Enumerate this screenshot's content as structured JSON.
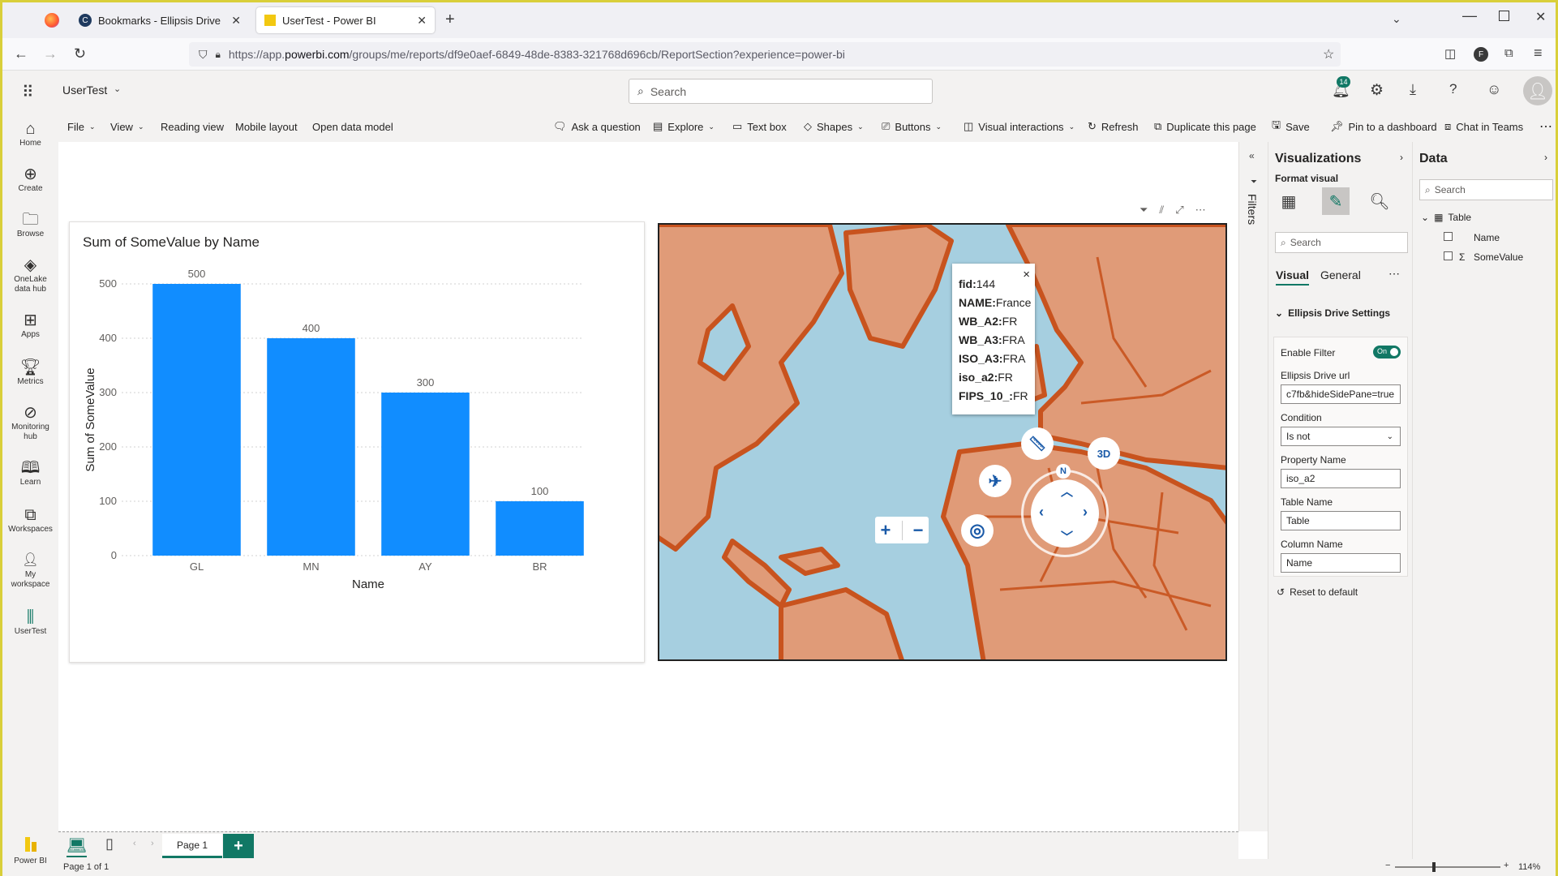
{
  "browser": {
    "tabs": [
      {
        "label": "Bookmarks - Ellipsis Drive"
      },
      {
        "label": "UserTest - Power BI"
      }
    ],
    "url_host": "https://app.",
    "url_domain": "powerbi.com",
    "url_path": "/groups/me/reports/df9e0aef-6849-48de-8383-321768d696cb/ReportSection?experience=power-bi",
    "profile_initial": "F"
  },
  "header": {
    "workspace": "UserTest",
    "search_placeholder": "Search",
    "notification_count": "14"
  },
  "ribbon": {
    "file": "File",
    "view": "View",
    "reading_view": "Reading view",
    "mobile_layout": "Mobile layout",
    "open_data_model": "Open data model",
    "ask_question": "Ask a question",
    "explore": "Explore",
    "text_box": "Text box",
    "shapes": "Shapes",
    "buttons": "Buttons",
    "visual_interactions": "Visual interactions",
    "refresh": "Refresh",
    "duplicate_page": "Duplicate this page",
    "save": "Save",
    "pin_dashboard": "Pin to a dashboard",
    "chat_teams": "Chat in Teams"
  },
  "leftnav": {
    "items": [
      {
        "label": "Home"
      },
      {
        "label": "Create"
      },
      {
        "label": "Browse"
      },
      {
        "label": "OneLake data hub"
      },
      {
        "label": "Apps"
      },
      {
        "label": "Metrics"
      },
      {
        "label": "Monitoring hub"
      },
      {
        "label": "Learn"
      },
      {
        "label": "Workspaces"
      },
      {
        "label": "My workspace"
      },
      {
        "label": "UserTest"
      }
    ],
    "brand": "Power BI"
  },
  "chart_data": {
    "type": "bar",
    "title": "Sum of SomeValue by Name",
    "xlabel": "Name",
    "ylabel": "Sum of SomeValue",
    "categories": [
      "GL",
      "MN",
      "AY",
      "BR"
    ],
    "values": [
      500,
      400,
      300,
      100
    ],
    "yticks": [
      0,
      100,
      200,
      300,
      400,
      500
    ],
    "ylim": [
      0,
      500
    ],
    "bar_color": "#118DFF",
    "grid": true
  },
  "map_popup": {
    "rows": [
      {
        "key": "fid:",
        "value": "144"
      },
      {
        "key": "NAME:",
        "value": "France"
      },
      {
        "key": "WB_A2:",
        "value": "FR"
      },
      {
        "key": "WB_A3:",
        "value": "FRA"
      },
      {
        "key": "ISO_A3:",
        "value": "FRA"
      },
      {
        "key": "iso_a2:",
        "value": "FR"
      },
      {
        "key": "FIPS_10_:",
        "value": "FR"
      }
    ],
    "close": "×",
    "compass_label": "N",
    "three_d_label": "3D"
  },
  "filters": {
    "label": "Filters"
  },
  "viz_pane": {
    "title": "Visualizations",
    "format_visual": "Format visual",
    "search_placeholder": "Search",
    "tab_visual": "Visual",
    "tab_general": "General",
    "section": "Ellipsis Drive Settings",
    "enable_filter": "Enable Filter",
    "toggle": "On",
    "url_label": "Ellipsis Drive url",
    "url_value": "c7fb&hideSidePane=true",
    "condition_label": "Condition",
    "condition_value": "Is not",
    "property_label": "Property Name",
    "property_value": "iso_a2",
    "table_label": "Table Name",
    "table_value": "Table",
    "column_label": "Column Name",
    "column_value": "Name",
    "reset": "Reset to default"
  },
  "data_pane": {
    "title": "Data",
    "search_placeholder": "Search",
    "table": "Table",
    "fields": [
      {
        "name": "Name",
        "sigma": ""
      },
      {
        "name": "SomeValue",
        "sigma": "Σ"
      }
    ]
  },
  "pages": {
    "tab": "Page 1",
    "status": "Page 1 of 1",
    "zoom": "114%"
  }
}
